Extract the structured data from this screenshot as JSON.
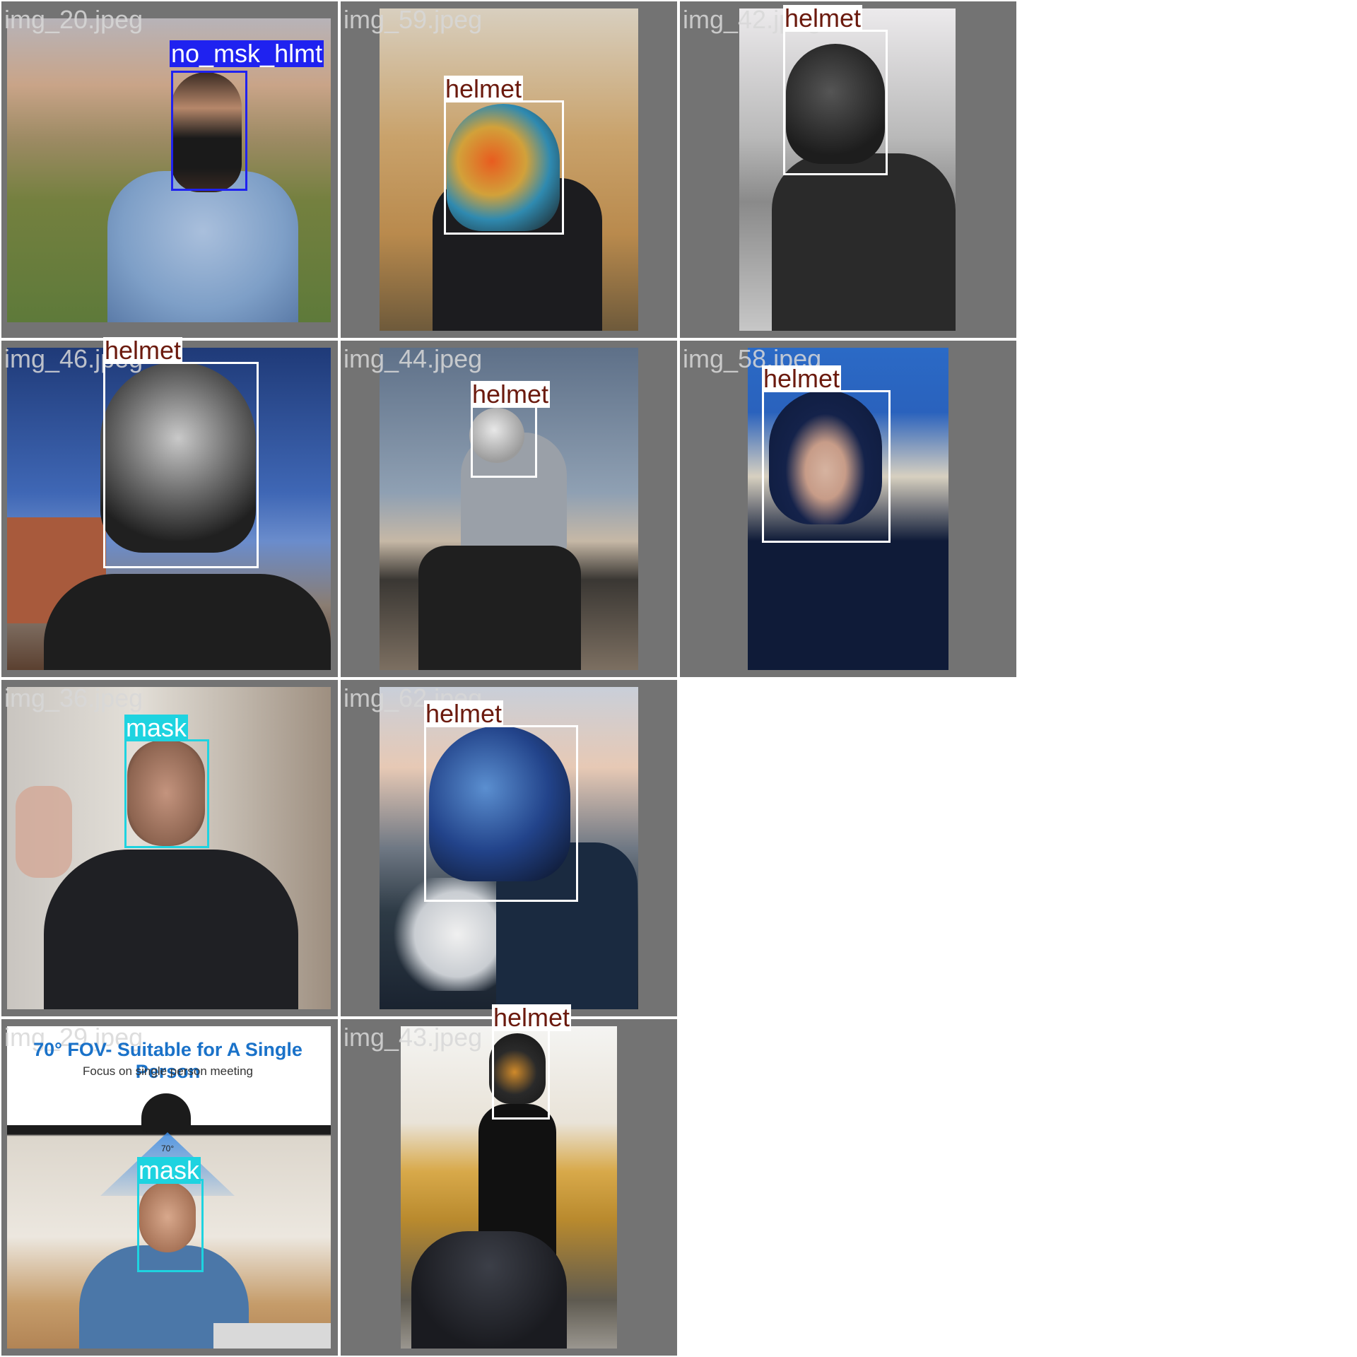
{
  "tiles": [
    {
      "filename": "img_20.jpeg"
    },
    {
      "filename": "img_59.jpeg"
    },
    {
      "filename": "img_42.jpeg"
    },
    {
      "filename": "img_46.jpeg"
    },
    {
      "filename": "img_44.jpeg"
    },
    {
      "filename": "img_58.jpeg"
    },
    {
      "filename": "img_36.jpeg"
    },
    {
      "filename": "img_62.jpeg"
    },
    {
      "filename": "img_29.jpeg"
    },
    {
      "filename": "img_43.jpeg"
    }
  ],
  "detections": [
    {
      "label": "no_msk_hlmt",
      "color": "#1f22f0",
      "text_color": "#ffffff"
    },
    {
      "label": "helmet",
      "color": "#ffffff",
      "text_color": "#6b1a0e"
    },
    {
      "label": "helmet",
      "color": "#ffffff",
      "text_color": "#6b1a0e"
    },
    {
      "label": "helmet",
      "color": "#ffffff",
      "text_color": "#6b1a0e"
    },
    {
      "label": "helmet",
      "color": "#ffffff",
      "text_color": "#6b1a0e"
    },
    {
      "label": "helmet",
      "color": "#ffffff",
      "text_color": "#6b1a0e"
    },
    {
      "label": "mask",
      "color": "#1ed3e0",
      "text_color": "#ffffff"
    },
    {
      "label": "helmet",
      "color": "#ffffff",
      "text_color": "#6b1a0e"
    },
    {
      "label": "mask",
      "color": "#1ed3e0",
      "text_color": "#ffffff"
    },
    {
      "label": "helmet",
      "color": "#ffffff",
      "text_color": "#6b1a0e"
    }
  ],
  "ad": {
    "title": "70° FOV- Suitable for A Single Person",
    "subtitle": "Focus on single person meeting",
    "angle": "70°"
  }
}
